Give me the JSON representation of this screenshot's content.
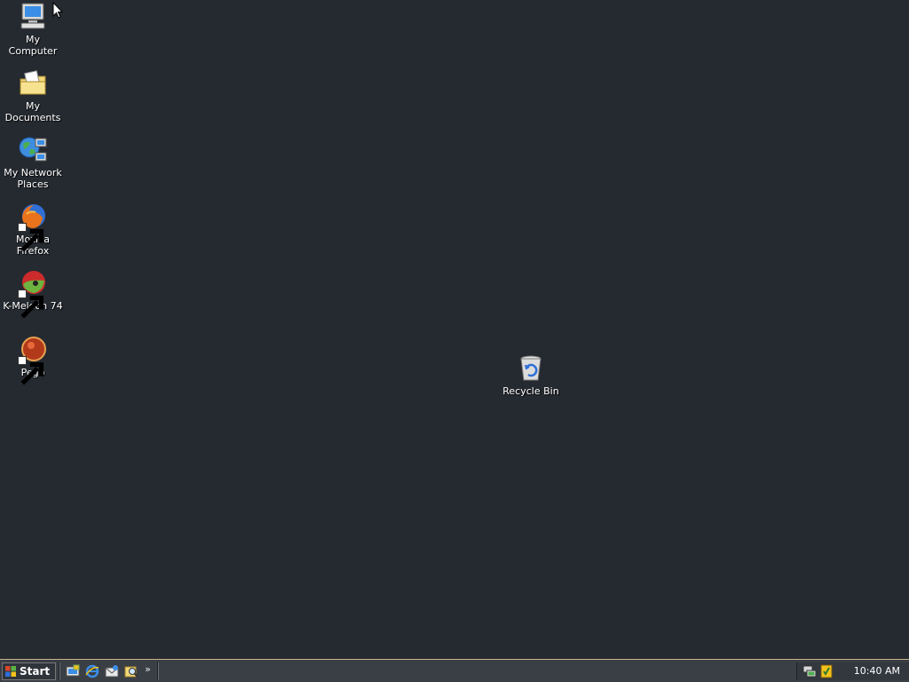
{
  "desktop": {
    "icons": [
      {
        "label": "My Computer",
        "icon": "my-computer-icon"
      },
      {
        "label": "My Documents",
        "icon": "my-documents-icon"
      },
      {
        "label": "My Network Places",
        "icon": "network-places-icon"
      },
      {
        "label": "Mozilla Firefox",
        "icon": "firefox-icon",
        "shortcut": true
      },
      {
        "label": "K-Meleon 74",
        "icon": "kmeleon-icon",
        "shortcut": true
      },
      {
        "label": "Pego",
        "icon": "pego-icon",
        "shortcut": true
      },
      {
        "label": "Recycle Bin",
        "icon": "recycle-bin-icon"
      }
    ],
    "background_color": "#252a31"
  },
  "taskbar": {
    "start_label": "Start",
    "quick_launch": [
      {
        "icon": "show-desktop-icon"
      },
      {
        "icon": "internet-explorer-icon"
      },
      {
        "icon": "outlook-express-icon"
      },
      {
        "icon": "search-icon"
      }
    ],
    "quick_launch_more": "»",
    "tray_icons": [
      {
        "icon": "network-tray-icon"
      },
      {
        "icon": "security-tray-icon"
      }
    ],
    "clock": "10:40 AM"
  }
}
